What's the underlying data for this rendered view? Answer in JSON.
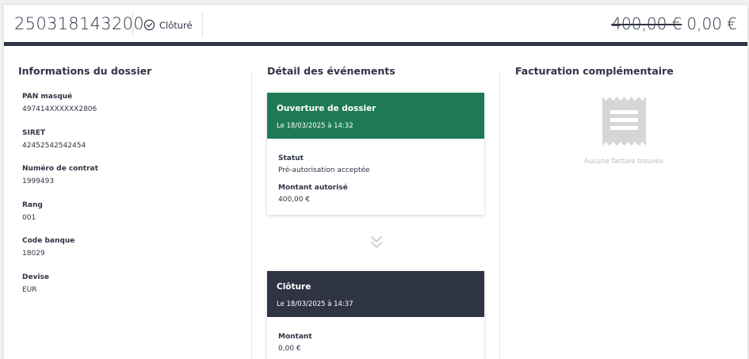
{
  "header": {
    "dossier_id": "250318143200",
    "status_label": "Clôturé",
    "old_amount": "400,00 €",
    "new_amount": "0,00 €"
  },
  "info": {
    "title": "Informations du dossier",
    "fields": [
      {
        "label": "PAN masqué",
        "value": "497414XXXXXX2806"
      },
      {
        "label": "SIRET",
        "value": "42452542542454"
      },
      {
        "label": "Numéro de contrat",
        "value": "1999493"
      },
      {
        "label": "Rang",
        "value": "001"
      },
      {
        "label": "Code banque",
        "value": "18029"
      },
      {
        "label": "Devise",
        "value": "EUR"
      }
    ]
  },
  "events": {
    "title": "Détail des événements",
    "items": [
      {
        "title": "Ouverture de dossier",
        "date": "Le 18/03/2025 à 14:32",
        "color": "#1e7a54",
        "fields": [
          {
            "label": "Statut",
            "value": "Pré-autorisation acceptée"
          },
          {
            "label": "Montant autorisé",
            "value": "400,00 €"
          }
        ]
      },
      {
        "title": "Clôture",
        "date": "Le 18/03/2025 à 14:37",
        "color": "#2e3444",
        "fields": [
          {
            "label": "Montant",
            "value": "0,00 €"
          }
        ]
      }
    ]
  },
  "billing": {
    "title": "Facturation complémentaire",
    "empty_text": "Aucune facture trouvée",
    "icon": "receipt-icon"
  },
  "colors": {
    "primary_dark": "#2e3444",
    "green": "#1e7a54",
    "muted": "#bdbdbd"
  }
}
